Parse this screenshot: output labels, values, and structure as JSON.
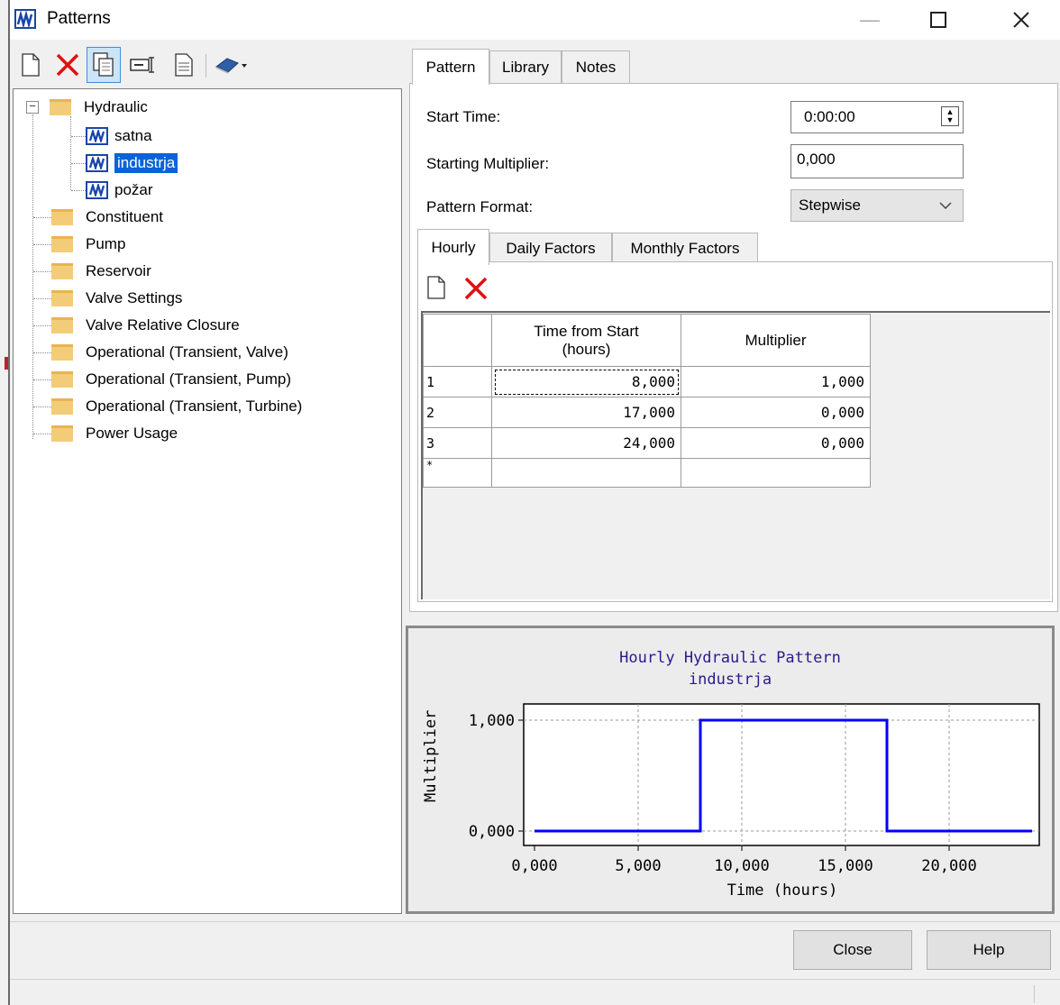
{
  "window": {
    "title": "Patterns"
  },
  "toolbar_left": {
    "icons": [
      "new-icon",
      "delete-icon",
      "duplicate-icon",
      "rename-icon",
      "report-icon",
      "library-book-icon"
    ]
  },
  "tree": {
    "root": {
      "label": "Hydraulic",
      "expanded": true,
      "children": [
        "satna",
        "industrja",
        "požar"
      ],
      "selected": "industrja"
    },
    "folders": [
      "Constituent",
      "Pump",
      "Reservoir",
      "Valve Settings",
      "Valve Relative Closure",
      "Operational (Transient, Valve)",
      "Operational (Transient, Pump)",
      "Operational (Transient, Turbine)",
      "Power Usage"
    ]
  },
  "tabs": {
    "pattern": "Pattern",
    "library": "Library",
    "notes": "Notes",
    "active": "Pattern"
  },
  "form": {
    "start_time_label": "Start Time:",
    "start_time_value": "0:00:00",
    "starting_multiplier_label": "Starting Multiplier:",
    "starting_multiplier_value": "0,000",
    "pattern_format_label": "Pattern Format:",
    "pattern_format_value": "Stepwise"
  },
  "subtabs": {
    "hourly": "Hourly",
    "daily": "Daily Factors",
    "monthly": "Monthly Factors",
    "active": "Hourly"
  },
  "grid": {
    "col_time_line1": "Time from Start",
    "col_time_line2": "(hours)",
    "col_multiplier": "Multiplier",
    "rows": [
      {
        "index": "1",
        "time": "8,000",
        "multiplier": "1,000"
      },
      {
        "index": "2",
        "time": "17,000",
        "multiplier": "0,000"
      },
      {
        "index": "3",
        "time": "24,000",
        "multiplier": "0,000"
      }
    ],
    "new_row_marker": "*"
  },
  "chart_data": {
    "type": "line",
    "step": true,
    "title": "Hourly Hydraulic Pattern",
    "subtitle": "industrja",
    "xlabel": "Time (hours)",
    "ylabel": "Multiplier",
    "xlim": [
      0,
      24
    ],
    "ylim": [
      0,
      1
    ],
    "x_ticks": [
      "0,000",
      "5,000",
      "10,000",
      "15,000",
      "20,000"
    ],
    "y_ticks": [
      "0,000",
      "1,000"
    ],
    "grid": true,
    "series": [
      {
        "x": [
          0,
          8,
          8,
          17,
          17,
          24
        ],
        "y": [
          0,
          0,
          1,
          1,
          0,
          0
        ],
        "color": "#0000ff"
      }
    ]
  },
  "buttons": {
    "close": "Close",
    "help": "Help"
  },
  "colors": {
    "selection": "#0a63d8",
    "icon_blue": "#1a45a8",
    "delete_red": "#e01010",
    "chart_line": "#0000ff",
    "chart_title": "#2a1b8c"
  }
}
